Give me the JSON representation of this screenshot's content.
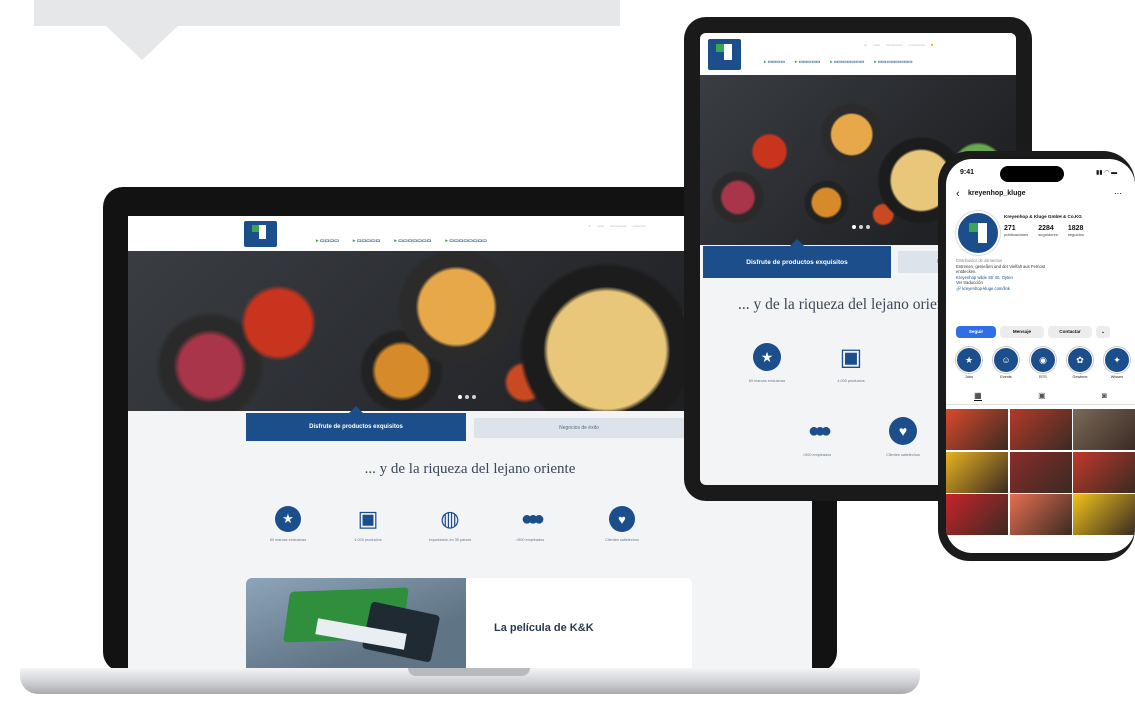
{
  "laptop": {
    "hero_tab_active": "Disfrute de productos exquisitos",
    "hero_tab_inactive": "Negocios de éxito",
    "tagline": "... y de la riqueza del lejano oriente",
    "video_title": "La película de K&K"
  },
  "tablet": {
    "hero_tab_active": "Disfrute de productos exquisitos",
    "hero_tab_inactive": "Negocios de éxito",
    "tagline": "... y de la riqueza del lejano oriente"
  },
  "phone": {
    "time": "9:41",
    "status": "▮▮ ◠ ▬",
    "username": "kreyenhop_kluge",
    "display_name": "Kreyenhop & Kluge GmbH & Co.KG",
    "stats": [
      {
        "value": "271",
        "label": "publicaciones"
      },
      {
        "value": "2284",
        "label": "seguidores"
      },
      {
        "value": "1828",
        "label": "seguidos"
      }
    ],
    "bio_category": "Distribuidor de alimentos",
    "bio_line1": "Entrenen, genießen und der Vielfalt aus Fernost",
    "bio_line2": "entdecken.",
    "bio_address": "Kreyenhop wilde Str 40, Oyten",
    "bio_more": "Ver traducción",
    "bio_link": "kreyenhop-kluge.com/link",
    "buttons": {
      "follow": "Seguir",
      "message": "Mensaje",
      "contact": "Contactar",
      "more": "⌄"
    },
    "highlights": [
      {
        "label": "Jobs",
        "icon": "★"
      },
      {
        "label": "Events",
        "icon": "☺"
      },
      {
        "label": "BTS",
        "icon": "◉"
      },
      {
        "label": "Gewinne",
        "icon": "✿"
      },
      {
        "label": "Wissen",
        "icon": "✦"
      }
    ],
    "tabs": [
      "▦",
      "▣",
      "◙"
    ],
    "grid_colors": [
      "#d94a2c",
      "#b33a2a",
      "#7a6a5a",
      "#e8b21f",
      "#8a2c2a",
      "#c0392b",
      "#c7242b",
      "#e76f51",
      "#f0c419"
    ]
  },
  "features": [
    {
      "icon": "star-badge",
      "label": "60 marcas exclusivas"
    },
    {
      "icon": "book-cart",
      "label": "4.000 productos"
    },
    {
      "icon": "globe",
      "label": "exportación en 35 países"
    },
    {
      "icon": "people",
      "label": ">500 empleados"
    },
    {
      "icon": "heart",
      "label": "Clientes satisfechos"
    }
  ],
  "colors": {
    "brand_blue": "#1c4e8c",
    "brand_green": "#3aa655",
    "ig_blue": "#2f6fe6"
  }
}
